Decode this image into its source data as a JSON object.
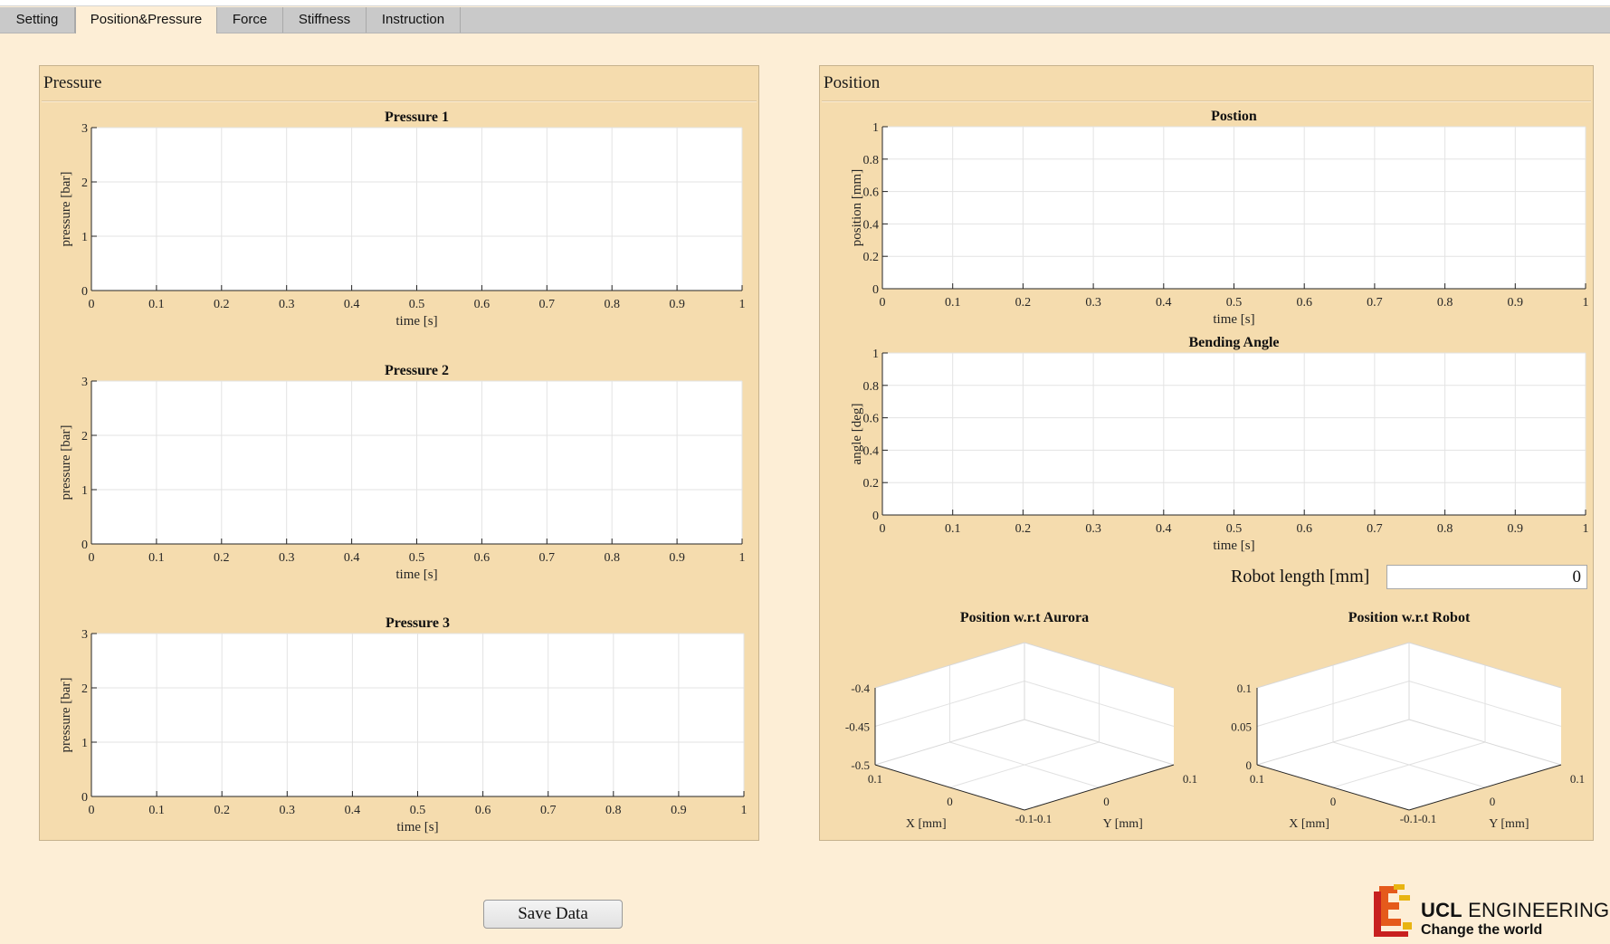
{
  "tabs": [
    {
      "label": "Setting",
      "active": false
    },
    {
      "label": "Position&Pressure",
      "active": true
    },
    {
      "label": "Force",
      "active": false
    },
    {
      "label": "Stiffness",
      "active": false
    },
    {
      "label": "Instruction",
      "active": false
    }
  ],
  "pressure_panel": {
    "title": "Pressure"
  },
  "position_panel": {
    "title": "Position"
  },
  "robot_length": {
    "label": "Robot length [mm]",
    "value": "0"
  },
  "save_button": {
    "label": "Save Data"
  },
  "logo": {
    "line1_bold": "UCL",
    "line1_rest": " ENGINEERING",
    "line2": "Change the world",
    "colors": [
      "#e8b411",
      "#e55a1b",
      "#c8201f"
    ]
  },
  "chart_data": [
    {
      "id": "pressure1",
      "type": "line",
      "title": "Pressure 1",
      "xlabel": "time [s]",
      "ylabel": "pressure [bar]",
      "xlim": [
        0,
        1
      ],
      "ylim": [
        0,
        3
      ],
      "xticks": [
        "0",
        "0.1",
        "0.2",
        "0.3",
        "0.4",
        "0.5",
        "0.6",
        "0.7",
        "0.8",
        "0.9",
        "1"
      ],
      "yticks": [
        "0",
        "1",
        "2",
        "3"
      ],
      "grid": true,
      "series": []
    },
    {
      "id": "pressure2",
      "type": "line",
      "title": "Pressure 2",
      "xlabel": "time [s]",
      "ylabel": "pressure [bar]",
      "xlim": [
        0,
        1
      ],
      "ylim": [
        0,
        3
      ],
      "xticks": [
        "0",
        "0.1",
        "0.2",
        "0.3",
        "0.4",
        "0.5",
        "0.6",
        "0.7",
        "0.8",
        "0.9",
        "1"
      ],
      "yticks": [
        "0",
        "1",
        "2",
        "3"
      ],
      "grid": true,
      "series": []
    },
    {
      "id": "pressure3",
      "type": "line",
      "title": "Pressure 3",
      "xlabel": "time [s]",
      "ylabel": "pressure [bar]",
      "xlim": [
        0,
        1
      ],
      "ylim": [
        0,
        3
      ],
      "xticks": [
        "0",
        "0.1",
        "0.2",
        "0.3",
        "0.4",
        "0.5",
        "0.6",
        "0.7",
        "0.8",
        "0.9",
        "1"
      ],
      "yticks": [
        "0",
        "1",
        "2",
        "3"
      ],
      "grid": true,
      "series": []
    },
    {
      "id": "position",
      "type": "line",
      "title": "Postion",
      "xlabel": "time [s]",
      "ylabel": "position [mm]",
      "xlim": [
        0,
        1
      ],
      "ylim": [
        0,
        1
      ],
      "xticks": [
        "0",
        "0.1",
        "0.2",
        "0.3",
        "0.4",
        "0.5",
        "0.6",
        "0.7",
        "0.8",
        "0.9",
        "1"
      ],
      "yticks": [
        "0",
        "0.2",
        "0.4",
        "0.6",
        "0.8",
        "1"
      ],
      "grid": true,
      "series": []
    },
    {
      "id": "bending",
      "type": "line",
      "title": "Bending Angle",
      "xlabel": "time [s]",
      "ylabel": "angle [deg]",
      "xlim": [
        0,
        1
      ],
      "ylim": [
        0,
        1
      ],
      "xticks": [
        "0",
        "0.1",
        "0.2",
        "0.3",
        "0.4",
        "0.5",
        "0.6",
        "0.7",
        "0.8",
        "0.9",
        "1"
      ],
      "yticks": [
        "0",
        "0.2",
        "0.4",
        "0.6",
        "0.8",
        "1"
      ],
      "grid": true,
      "series": []
    },
    {
      "id": "aurora3d",
      "type": "scatter",
      "title": "Position w.r.t Aurora",
      "xlabel": "X [mm]",
      "ylabel": "Y [mm]",
      "xticks": [
        "-0.1",
        "0",
        "0.1"
      ],
      "yticks": [
        "-0.1",
        "0",
        "0.1"
      ],
      "zticks": [
        "-0.5",
        "-0.45",
        "-0.4"
      ],
      "grid": true,
      "series": []
    },
    {
      "id": "robot3d",
      "type": "scatter",
      "title": "Position w.r.t Robot",
      "xlabel": "X [mm]",
      "ylabel": "Y [mm]",
      "xticks": [
        "-0.1",
        "0",
        "0.1"
      ],
      "yticks": [
        "-0.1",
        "0",
        "0.1"
      ],
      "zticks": [
        "0",
        "0.05",
        "0.1"
      ],
      "grid": true,
      "series": []
    }
  ]
}
